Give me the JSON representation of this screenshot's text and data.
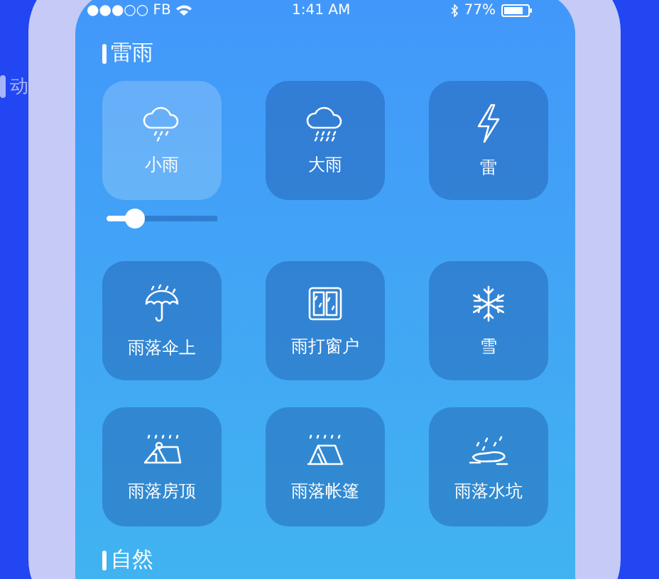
{
  "background_label": "动",
  "status_bar": {
    "carrier": "●●●○○ FB",
    "time": "1:41 AM",
    "battery": "77%"
  },
  "sections": [
    {
      "title": "雷雨",
      "tiles": [
        {
          "label": "小雨",
          "selected": true,
          "volume": {
            "level": 0.25
          }
        },
        {
          "label": "大雨",
          "selected": false
        },
        {
          "label": "雷",
          "selected": false
        },
        {
          "label": "雨落伞上",
          "selected": false
        },
        {
          "label": "雨打窗户",
          "selected": false
        },
        {
          "label": "雪",
          "selected": false
        },
        {
          "label": "雨落房顶",
          "selected": false
        },
        {
          "label": "雨落帐篷",
          "selected": false
        },
        {
          "label": "雨落水坑",
          "selected": false
        }
      ]
    },
    {
      "title": "自然"
    }
  ]
}
